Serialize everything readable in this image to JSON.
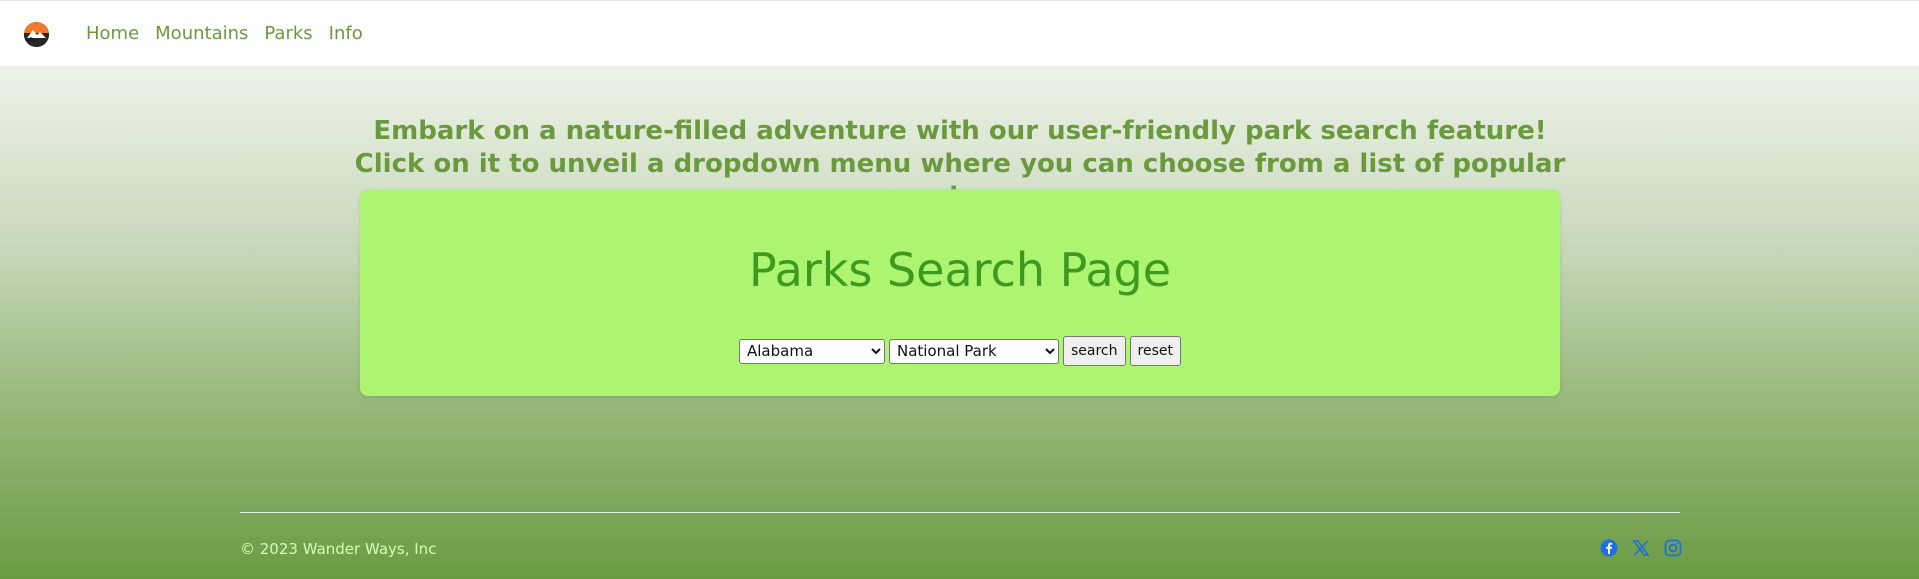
{
  "nav": {
    "links": [
      "Home",
      "Mountains",
      "Parks",
      "Info"
    ]
  },
  "intro": {
    "text": "Embark on a nature-filled adventure with our user-friendly park search feature! Click on it to unveil a dropdown menu where you can choose from a list of popular regions."
  },
  "search": {
    "title": "Parks Search Page",
    "state_selected": "Alabama",
    "type_selected": "National Park",
    "search_label": "search",
    "reset_label": "reset"
  },
  "footer": {
    "copyright": "© 2023 Wander Ways, Inc",
    "socials": [
      "facebook-icon",
      "x-icon",
      "instagram-icon"
    ]
  },
  "colors": {
    "nav_link": "#6a9a3d",
    "card_bg": "#adf571",
    "card_title": "#3d9a1f",
    "social_icon": "#1d6fe0"
  }
}
